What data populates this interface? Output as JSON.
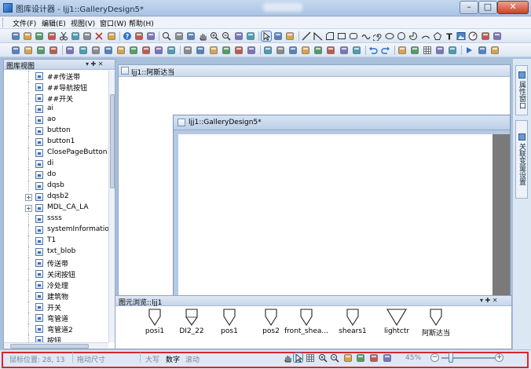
{
  "window": {
    "title": "图库设计器 - ljj1::GalleryDesign5*",
    "minimize_glyph": "–",
    "maximize_glyph": "□",
    "close_glyph": "✕"
  },
  "menu": [
    {
      "label": "文件(F)"
    },
    {
      "label": "编辑(E)"
    },
    {
      "label": "视图(V)"
    },
    {
      "label": "窗口(W)"
    },
    {
      "label": "帮助(H)"
    }
  ],
  "toolbar1_icons": [
    "new-icon",
    "open-icon",
    "save-as-icon",
    "save-icon",
    "cut-icon",
    "copy-icon",
    "paste-icon",
    "delete-icon",
    "print-icon",
    "help-icon",
    "gallery-icon",
    "color-icon",
    "zoom-icon",
    "zoom-fit-icon",
    "zoom-page-icon",
    "pan-icon",
    "zoom-in-icon",
    "zoom-out-icon",
    "zoom-width-icon",
    "zoom-height-icon",
    "select-icon",
    "node-edit-icon",
    "rotate-icon",
    "line-icon",
    "polyline-icon",
    "corner-rect-icon",
    "rectangle-icon",
    "rounded-rect-icon",
    "wave-icon",
    "spiral-icon",
    "ellipse-icon",
    "circle-icon",
    "pie-icon",
    "arc-icon",
    "polygon-icon",
    "text-icon",
    "image-icon",
    "gauge-icon",
    "button-icon",
    "listbox-icon"
  ],
  "toolbar2_icons": [
    "rotate-left-icon",
    "rotate-right-icon",
    "flip-h-icon",
    "flip-v-icon",
    "align-left-icon",
    "align-center-icon",
    "align-right-icon",
    "align-top-icon",
    "align-middle-icon",
    "align-bottom-icon",
    "same-width-icon",
    "same-height-icon",
    "same-size-icon",
    "bring-front-icon",
    "send-back-icon",
    "bring-forward-icon",
    "send-backward-icon",
    "group-icon",
    "ungroup-icon",
    "lock-icon",
    "unlock-icon",
    "distribute-h-icon",
    "distribute-v-icon",
    "space-h-icon",
    "space-v-icon",
    "center-h-icon",
    "center-v-icon",
    "undo-icon",
    "redo-icon",
    "note-icon",
    "table-icon",
    "grid-icon",
    "ruler-icon",
    "snap-icon",
    "run-icon",
    "properties-icon",
    "layout-icon"
  ],
  "library_panel": {
    "title": "图库视图",
    "pin_glyph": "▾ ✚ ✕",
    "items": [
      {
        "label": "##传送带",
        "expandable": false
      },
      {
        "label": "##导航按钮",
        "expandable": false
      },
      {
        "label": "##开关",
        "expandable": false
      },
      {
        "label": "ai",
        "expandable": false
      },
      {
        "label": "ao",
        "expandable": false
      },
      {
        "label": "button",
        "expandable": false
      },
      {
        "label": "button1",
        "expandable": false
      },
      {
        "label": "ClosePageButton",
        "expandable": false
      },
      {
        "label": "di",
        "expandable": false
      },
      {
        "label": "do",
        "expandable": false
      },
      {
        "label": "dqsb",
        "expandable": false
      },
      {
        "label": "dqsb2",
        "expandable": true
      },
      {
        "label": "MDL_CA_LA",
        "expandable": true
      },
      {
        "label": "ssss",
        "expandable": false
      },
      {
        "label": "systemInformation",
        "expandable": false
      },
      {
        "label": "T1",
        "expandable": false
      },
      {
        "label": "txt_blob",
        "expandable": false
      },
      {
        "label": "传送带",
        "expandable": false
      },
      {
        "label": "关闭按钮",
        "expandable": false
      },
      {
        "label": "冷处理",
        "expandable": false
      },
      {
        "label": "建筑物",
        "expandable": false
      },
      {
        "label": "开关",
        "expandable": false
      },
      {
        "label": "弯管道",
        "expandable": false
      },
      {
        "label": "弯管道2",
        "expandable": false
      },
      {
        "label": "按钮",
        "expandable": false
      }
    ]
  },
  "documents": {
    "outer_title": "ljj1::阿斯达当",
    "inner_title": "ljj1::GalleryDesign5*"
  },
  "right_tabs": [
    {
      "label": "属性窗口"
    },
    {
      "label": "关联变量设置"
    }
  ],
  "gallery_browser": {
    "title": "图元浏览::ljj1",
    "pin_glyph": "▾ ✚ ✕",
    "items": [
      {
        "label": "posi1",
        "shape": "valve"
      },
      {
        "label": "DI2_22",
        "shape": "valve-square"
      },
      {
        "label": "pos1",
        "shape": "valve"
      },
      {
        "label": "pos2",
        "shape": "valve"
      },
      {
        "label": "front_shea...",
        "shape": "valve"
      },
      {
        "label": "shears1",
        "shape": "valve"
      },
      {
        "label": "lightctr",
        "shape": "valve-wide"
      },
      {
        "label": "阿斯达当",
        "shape": "valve"
      }
    ]
  },
  "status": {
    "mouse_position": "鼠标位置: 28, 13",
    "drag_size": "拖动尺寸",
    "caps": "大写",
    "num": "数字",
    "scroll": "滚动",
    "zoom": "45%",
    "zoom_level": 0.45,
    "zoom_minus": "−",
    "zoom_plus": "+",
    "icons": [
      "pan-icon",
      "select-icon",
      "grid-icon",
      "zoom-in-icon",
      "zoom-out-icon",
      "zoom-fit-icon",
      "zoom-page-icon",
      "zoom-width-icon",
      "zoom-height-icon"
    ]
  },
  "colors": {
    "highlight_frame": "#d9262b",
    "canvas_gutter": "#7a7a7a"
  }
}
